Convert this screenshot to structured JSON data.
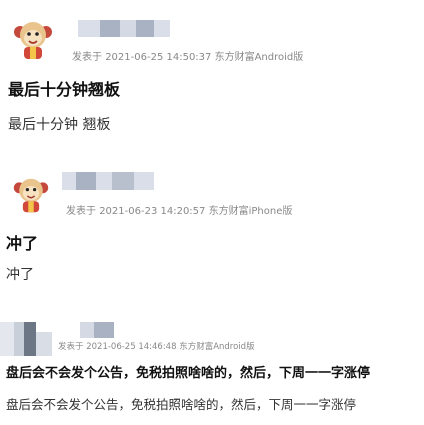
{
  "posts": [
    {
      "meta_prefix": "发表于",
      "datetime": "2021-06-25 14:50:37",
      "source": "东方财富Android版",
      "title": "最后十分钟翘板",
      "content": "最后十分钟 翘板",
      "avatar_icon": "monkey-avatar-icon"
    },
    {
      "meta_prefix": "发表于",
      "datetime": "2021-06-23 14:20:57",
      "source": "东方财富iPhone版",
      "title": "冲了",
      "content": "冲了",
      "avatar_icon": "monkey-avatar-icon"
    },
    {
      "meta_prefix": "发表于",
      "datetime": "2021-06-25 14:46:48",
      "source": "东方财富Android版",
      "title": "盘后会不会发个公告，免税拍照啥啥的，然后，下周一一字涨停",
      "content": "盘后会不会发个公告，免税拍照啥啥的，然后，下周一一字涨停",
      "avatar_icon": "blurred-avatar-icon"
    }
  ],
  "colors": {
    "meta": "#888888",
    "title": "#111111",
    "blur_light": "#d9dee8",
    "blur_dark": "#a9b2c3"
  }
}
